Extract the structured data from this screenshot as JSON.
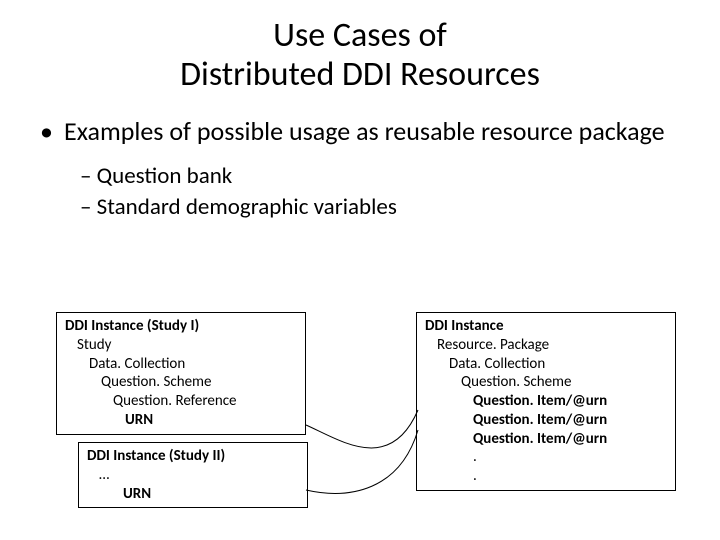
{
  "title_line1": "Use Cases of",
  "title_line2": "Distributed DDI Resources",
  "bullet": "Examples of possible usage as reusable resource package",
  "subs": [
    "Question bank",
    "Standard demographic variables"
  ],
  "box1": {
    "l0": "DDI Instance (Study I)",
    "l1": "Study",
    "l2": "Data. Collection",
    "l3": "Question. Scheme",
    "l4": "Question. Reference",
    "l5": "URN"
  },
  "box2": {
    "l0": "DDI Instance (Study II)",
    "l1": "…",
    "l2": "URN"
  },
  "box3": {
    "l0": "DDI Instance",
    "l1": "Resource. Package",
    "l2": "Data. Collection",
    "l3": "Question. Scheme",
    "l4": "Question. Item/@urn",
    "l5": "Question. Item/@urn",
    "l6": "Question. Item/@urn",
    "l7": ".",
    "l8": "."
  }
}
